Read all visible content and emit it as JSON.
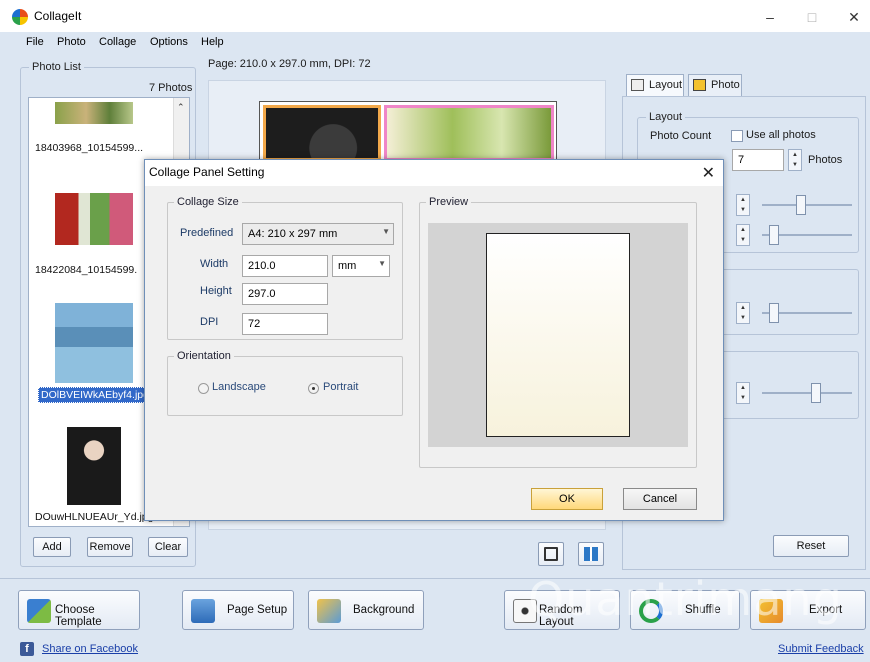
{
  "window": {
    "title": "CollageIt",
    "minimize": "–",
    "maximize": "□",
    "close": "✕"
  },
  "menu": [
    "File",
    "Photo",
    "Collage",
    "Options",
    "Help"
  ],
  "page_info": "Page: 210.0 x 297.0 mm, DPI: 72",
  "photo_list": {
    "legend": "Photo List",
    "count": "7 Photos",
    "items": [
      {
        "caption": "18403968_10154599..."
      },
      {
        "caption": "18422084_10154599."
      },
      {
        "caption": "DOlBVEIWkAEbyf4.jpg"
      },
      {
        "caption": "DOuwHLNUEAUr_Yd.jpg"
      }
    ],
    "add": "Add",
    "remove": "Remove",
    "clear": "Clear"
  },
  "right_panel": {
    "tab_layout": "Layout",
    "tab_photo": "Photo",
    "layout_legend": "Layout",
    "photo_count_label": "Photo Count",
    "use_all_photos": "Use all photos",
    "photo_count_value": "7",
    "photos_unit": "Photos",
    "reset": "Reset"
  },
  "dialog": {
    "title": "Collage Panel Setting",
    "close": "✕",
    "size_legend": "Collage Size",
    "predefined_label": "Predefined",
    "predefined_value": "A4: 210 x 297 mm",
    "width_label": "Width",
    "width_value": "210.0",
    "unit_value": "mm",
    "height_label": "Height",
    "height_value": "297.0",
    "dpi_label": "DPI",
    "dpi_value": "72",
    "orientation_legend": "Orientation",
    "landscape": "Landscape",
    "portrait": "Portrait",
    "preview_legend": "Preview",
    "ok": "OK",
    "cancel": "Cancel"
  },
  "bottom": {
    "choose_template": "Choose Template",
    "page_setup": "Page Setup",
    "background": "Background",
    "random_layout": "Random Layout",
    "shuffle": "Shuffle",
    "export": "Export",
    "share_facebook": "Share on Facebook",
    "submit_feedback": "Submit Feedback"
  },
  "watermark": "Quantrimang",
  "colors": {
    "selection": "#3168c9",
    "accent_border": "#ef86c8",
    "ok_highlight": "#ffd87a"
  },
  "icons": [
    "app-icon",
    "layout-tab-icon",
    "photo-tab-icon",
    "crop-icon",
    "fit-icon",
    "facebook-icon"
  ]
}
